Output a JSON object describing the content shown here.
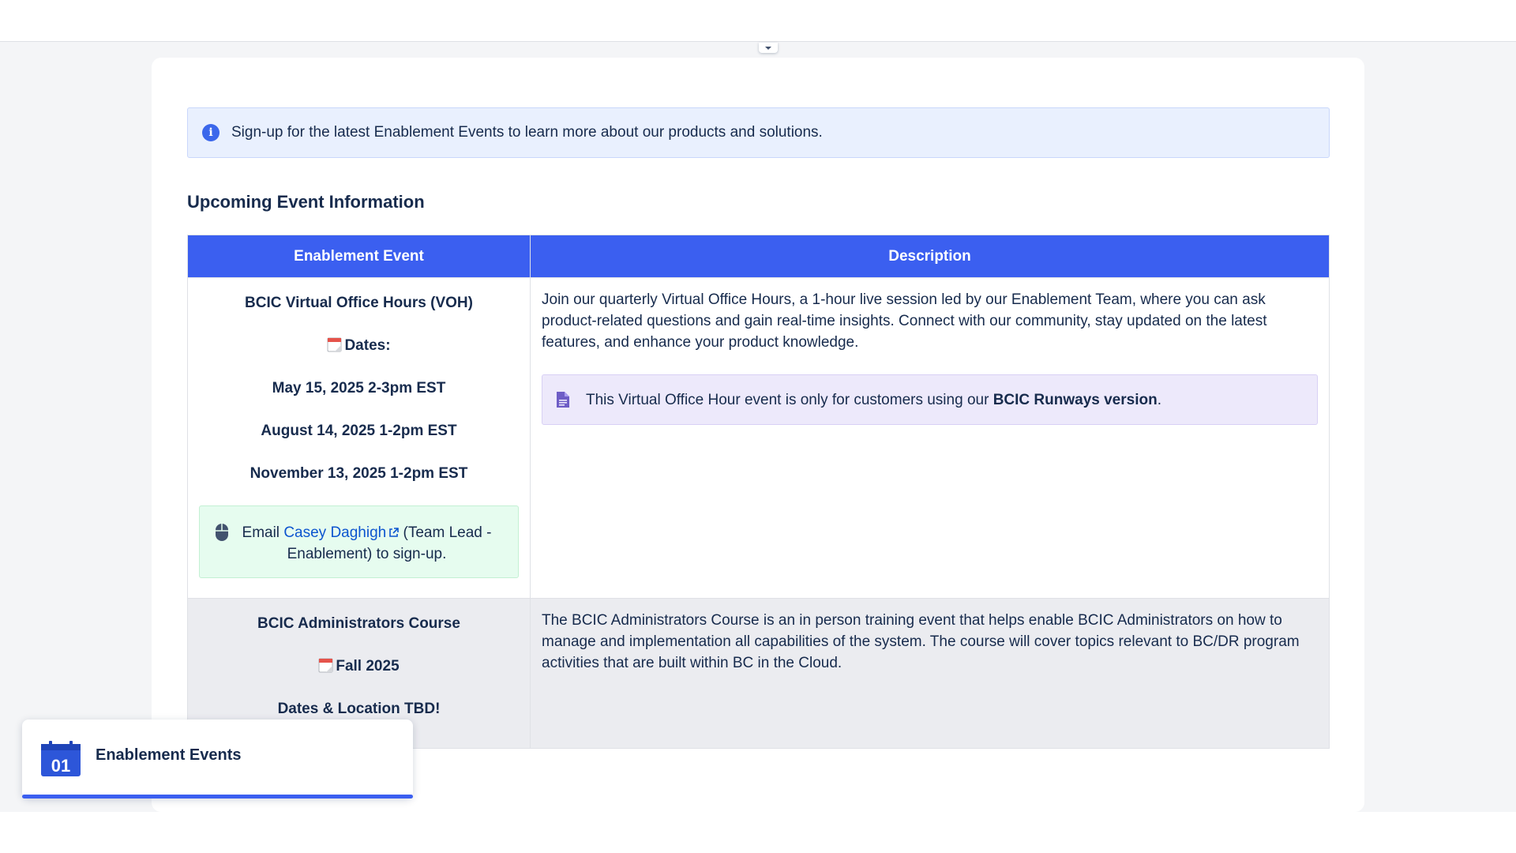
{
  "banner": {
    "text": "Sign-up for the latest Enablement Events to learn more about our products and solutions."
  },
  "section": {
    "heading": "Upcoming Event Information"
  },
  "table": {
    "headers": [
      "Enablement Event",
      "Description"
    ],
    "rows": [
      {
        "event_title": "BCIC Virtual Office Hours (VOH)",
        "dates_label": "Dates:",
        "dates": [
          "May 15, 2025 2-3pm EST",
          "August 14, 2025 1-2pm EST",
          "November 13, 2025 1-2pm EST"
        ],
        "signup": {
          "prefix": "Email ",
          "link_text": "Casey Daghigh",
          "suffix": " (Team Lead - Enablement) to sign-up."
        },
        "description": "Join our quarterly Virtual Office Hours, a 1-hour live session led by our Enablement Team, where you can ask product-related questions and gain real-time insights. Connect with our community, stay updated on the latest features, and enhance your product knowledge.",
        "note": {
          "prefix": "This Virtual Office Hour event is only for customers using our ",
          "bold": "BCIC Runways version",
          "suffix": "."
        }
      },
      {
        "event_title": "BCIC Administrators Course",
        "season": "Fall 2025",
        "location": "Dates & Location TBD!",
        "description": "The BCIC Administrators Course is an in person training event that helps enable BCIC Administrators on how to manage and implementation all capabilities of the system. The course will cover topics relevant to BC/DR program activities that are built within BC in the Cloud."
      }
    ]
  },
  "floating_card": {
    "title": "Enablement Events",
    "icon": "calendar-01-icon",
    "icon_text": "01"
  },
  "colors": {
    "header_blue": "#3b5ff0",
    "info_bg": "#e9f0fe",
    "note_bg": "#ede9fb",
    "success_bg": "#e6fcef",
    "link": "#0c55cf"
  }
}
